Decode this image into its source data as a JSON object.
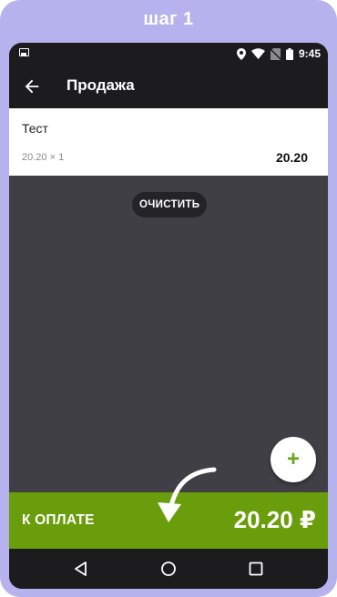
{
  "banner": {
    "title": "шаг 1"
  },
  "statusbar": {
    "time": "9:45",
    "icons": [
      "image-icon",
      "location-icon",
      "wifi-icon",
      "no-sim-icon",
      "battery-icon"
    ]
  },
  "appbar": {
    "title": "Продажа",
    "back_icon": "arrow-left-icon"
  },
  "item": {
    "name": "Тест",
    "price_qty": "20.20 × 1",
    "total": "20.20"
  },
  "actions": {
    "clear_label": "ОЧИСТИТЬ",
    "add_icon": "plus-icon",
    "add_glyph": "+"
  },
  "payment": {
    "label": "К ОПЛАТЕ",
    "amount": "20.20 ₽"
  },
  "navbar": {
    "icons": [
      "back-triangle-icon",
      "home-circle-icon",
      "recents-square-icon"
    ]
  },
  "colors": {
    "frame": "#b6b2ee",
    "appbar": "#1c1c1e",
    "content_bg": "#3f3f45",
    "accent_green": "#6a9d0b",
    "fab_plus": "#68a41d"
  }
}
